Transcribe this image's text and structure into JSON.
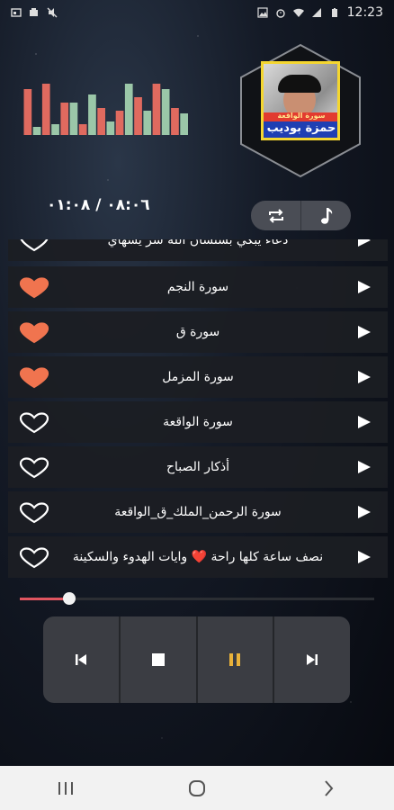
{
  "status_bar": {
    "time": "12:23",
    "left_icons": [
      "gallery-icon",
      "battery-saver-icon",
      "mute-icon"
    ],
    "right_icons": [
      "image-icon",
      "alarm-icon",
      "wifi-icon",
      "signal-icon",
      "battery-icon"
    ]
  },
  "equalizer": {
    "bar_levels": [
      0.85,
      0.15,
      0.95,
      0.2,
      0.6,
      0.6,
      0.2,
      0.75,
      0.5,
      0.25,
      0.45,
      0.95,
      0.7,
      0.45,
      0.95,
      0.85,
      0.5,
      0.4
    ],
    "colors": {
      "top": "#e06a5f",
      "bottom": "#9bc7a8"
    }
  },
  "album_art": {
    "line1": "سورة الواقعة",
    "line2": "حمزة بوديب"
  },
  "playback": {
    "elapsed": "٠١:٠٨",
    "separator": "/",
    "total": "٠٨:٠٦",
    "progress": 0.14
  },
  "buttons": {
    "repeat": "repeat-icon",
    "music": "music-note-icon"
  },
  "tracks": [
    {
      "title": "دعاء يبكي بستشان الله شر يشهاي",
      "favorite": false,
      "partial": true
    },
    {
      "title": "سورة النجم",
      "favorite": true
    },
    {
      "title": "سورة ق",
      "favorite": true
    },
    {
      "title": "سورة المزمل",
      "favorite": true
    },
    {
      "title": "سورة الواقعة",
      "favorite": false
    },
    {
      "title": "أذكار الصباح",
      "favorite": false
    },
    {
      "title": "سورة الرحمن_الملك_ق_الواقعة",
      "favorite": false
    },
    {
      "title": "نصف ساعة كلها راحة ❤️ وايات الهدوء والسكينة",
      "favorite": false
    }
  ],
  "controls": [
    "previous-icon",
    "stop-icon",
    "pause-icon",
    "next-icon"
  ],
  "colors": {
    "accent": "#f0744f",
    "pause": "#e9b23a",
    "heart_empty": "#ffffff"
  },
  "nav": [
    "recent-apps-icon",
    "home-icon",
    "back-icon"
  ]
}
